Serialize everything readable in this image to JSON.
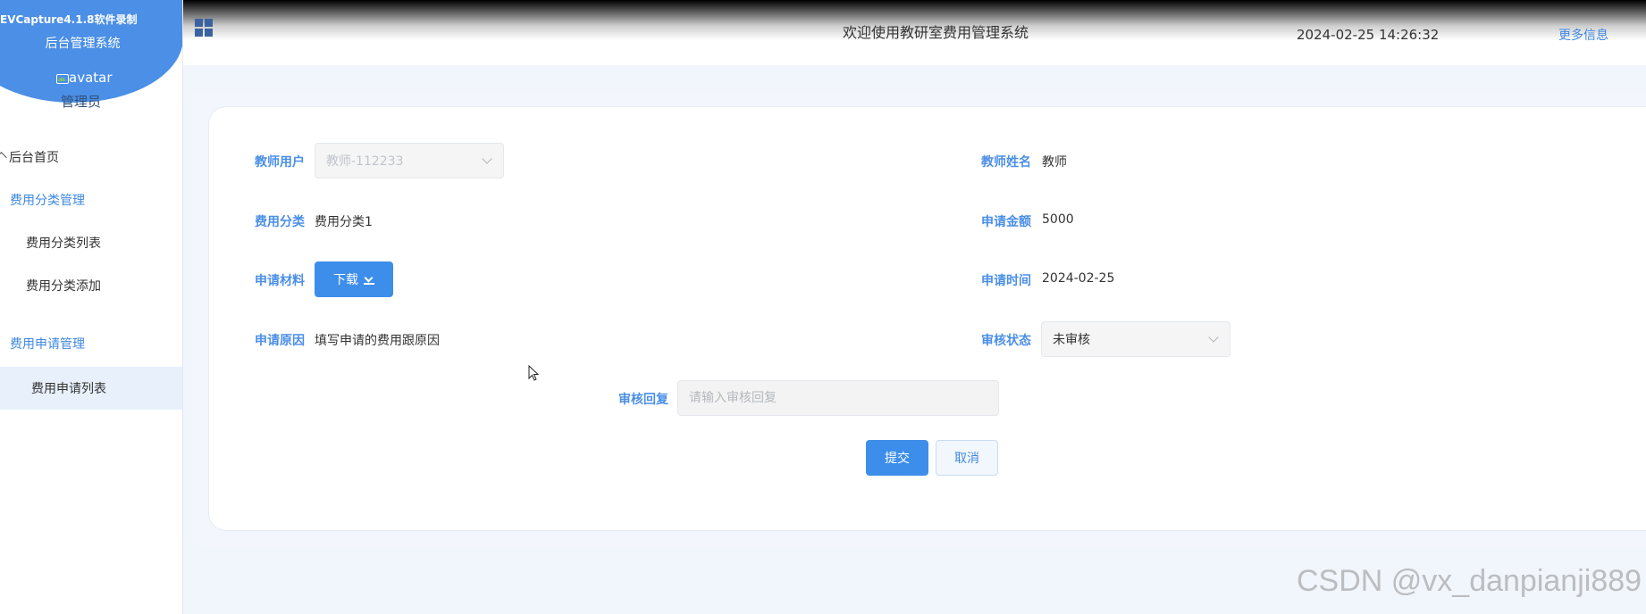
{
  "watermark": {
    "recorder": "EVCapture4.1.8软件录制",
    "csdn": "CSDN @vx_danpianji889"
  },
  "sidebar": {
    "system_title": "后台管理系统",
    "avatar_alt": "avatar",
    "admin_name": "管理员",
    "items": [
      {
        "label": "后台首页",
        "icon": "home-icon"
      },
      {
        "label": "费用分类管理",
        "type": "group"
      },
      {
        "label": "费用分类列表",
        "type": "sub"
      },
      {
        "label": "费用分类添加",
        "type": "sub"
      },
      {
        "label": "费用申请管理",
        "type": "group"
      },
      {
        "label": "费用申请列表",
        "type": "sub",
        "active": true
      }
    ]
  },
  "header": {
    "icon": "grid-menu-icon",
    "title": "欢迎使用教研室费用管理系统",
    "datetime": "2024-02-25 14:26:32",
    "more": "更多信息"
  },
  "form": {
    "teacher_user": {
      "label": "教师用户",
      "value": "教师-112233"
    },
    "teacher_name": {
      "label": "教师姓名",
      "value": "教师"
    },
    "category": {
      "label": "费用分类",
      "value": "费用分类1"
    },
    "amount": {
      "label": "申请金额",
      "value": "5000"
    },
    "material": {
      "label": "申请材料",
      "button": "下载"
    },
    "apply_time": {
      "label": "申请时间",
      "value": "2024-02-25"
    },
    "reason": {
      "label": "申请原因",
      "value": "填写申请的费用跟原因"
    },
    "review_status": {
      "label": "审核状态",
      "value": "未审核"
    },
    "review_reply": {
      "label": "审核回复",
      "placeholder": "请输入审核回复",
      "value": ""
    },
    "submit": "提交",
    "cancel": "取消"
  },
  "colors": {
    "accent": "#3d8eea",
    "label": "#4b8fe6",
    "sidebar_active": "#e8f0fb"
  }
}
